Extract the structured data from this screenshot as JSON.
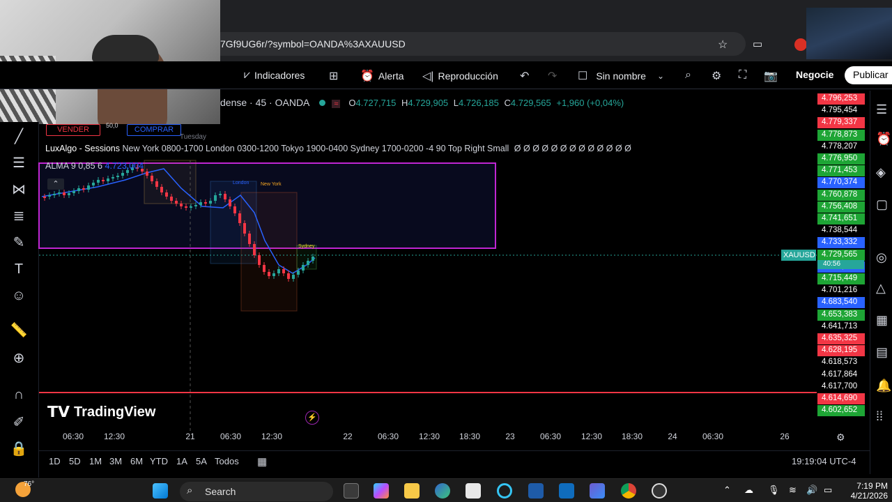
{
  "browser": {
    "url": "7Gf9UG6r/?symbol=OANDA%3AXAUUSD"
  },
  "toolbar": {
    "indicators_label": "Indicadores",
    "alert_label": "Alerta",
    "replay_label": "Reproducción",
    "layout_name": "Sin nombre",
    "trade_label": "Negocie",
    "publish_label": "Publicar"
  },
  "legend": {
    "symbol_title": "dense · 45 · OANDA",
    "open_key": "O",
    "open_val": "4.727,715",
    "high_key": "H",
    "high_val": "4.729,905",
    "low_key": "L",
    "low_val": "4.726,185",
    "close_key": "C",
    "close_val": "4.729,565",
    "change": "+1,960 (+0,04%)",
    "sell_label": "VENDER",
    "buy_label": "COMPRAR",
    "spread": "50,0",
    "day_hint": "Tuesday",
    "sessions_name": "LuxAlgo - Sessions",
    "sessions_params": "New York 0800-1700 London 0300-1200 Tokyo 1900-0400 Sydney 1700-0200 -4 90 Top Right Small",
    "sessions_tail": "Ø Ø Ø Ø Ø Ø Ø Ø Ø Ø Ø Ø Ø",
    "alma_name": "ALMA 9 0,85 6",
    "alma_value": "4.723,004"
  },
  "sessions": {
    "london": "London",
    "newyork": "New York",
    "sydney": "Sydney"
  },
  "chart_data": {
    "type": "candlestick",
    "symbol": "XAUUSD",
    "last_price": "4.729,565",
    "countdown": "40:56",
    "price_labels": [
      {
        "text": "4.796,253",
        "color": "#f23645"
      },
      {
        "text": "4.795,454",
        "color": "#000000"
      },
      {
        "text": "4.779,337",
        "color": "#f23645"
      },
      {
        "text": "4.778,873",
        "color": "#1ea535"
      },
      {
        "text": "4.778,207",
        "color": "#000000"
      },
      {
        "text": "4.776,950",
        "color": "#1ea535"
      },
      {
        "text": "4.771,453",
        "color": "#1ea535"
      },
      {
        "text": "4.770,374",
        "color": "#2962ff"
      },
      {
        "text": "4.760,878",
        "color": "#1ea535"
      },
      {
        "text": "4.756,408",
        "color": "#1ea535"
      },
      {
        "text": "4.741,651",
        "color": "#1ea535"
      },
      {
        "text": "4.738,544",
        "color": "#000000"
      },
      {
        "text": "4.733,332",
        "color": "#2962ff"
      },
      {
        "text": "4.729,565",
        "color": "#1ea535"
      },
      {
        "text": "4.723,004",
        "color": "#2962ff"
      },
      {
        "text": "4.715,449",
        "color": "#1ea535"
      },
      {
        "text": "4.701,216",
        "color": "#000000"
      },
      {
        "text": "4.683,540",
        "color": "#2962ff"
      },
      {
        "text": "4.653,383",
        "color": "#1ea535"
      },
      {
        "text": "4.641,713",
        "color": "#000000"
      },
      {
        "text": "4.635,325",
        "color": "#f23645"
      },
      {
        "text": "4.628,195",
        "color": "#f23645"
      },
      {
        "text": "4.618,573",
        "color": "#000000"
      },
      {
        "text": "4.617,864",
        "color": "#000000"
      },
      {
        "text": "4.617,700",
        "color": "#000000"
      },
      {
        "text": "4.614,690",
        "color": "#f23645"
      },
      {
        "text": "4.602,652",
        "color": "#1ea535"
      }
    ],
    "time_labels": [
      "06:30",
      "12:30",
      "21",
      "06:30",
      "12:30",
      "22",
      "06:30",
      "12:30",
      "18:30",
      "23",
      "06:30",
      "12:30",
      "18:30",
      "24",
      "06:30",
      "26"
    ]
  },
  "branding": {
    "tv_name": "TradingView"
  },
  "ranges": [
    "1D",
    "5D",
    "1M",
    "3M",
    "6M",
    "YTD",
    "1A",
    "5A",
    "Todos"
  ],
  "clock": "19:19:04 UTC-4",
  "taskbar": {
    "search": "Search",
    "temp": "76°",
    "time": "7:19 PM",
    "date": "4/21/2026"
  }
}
